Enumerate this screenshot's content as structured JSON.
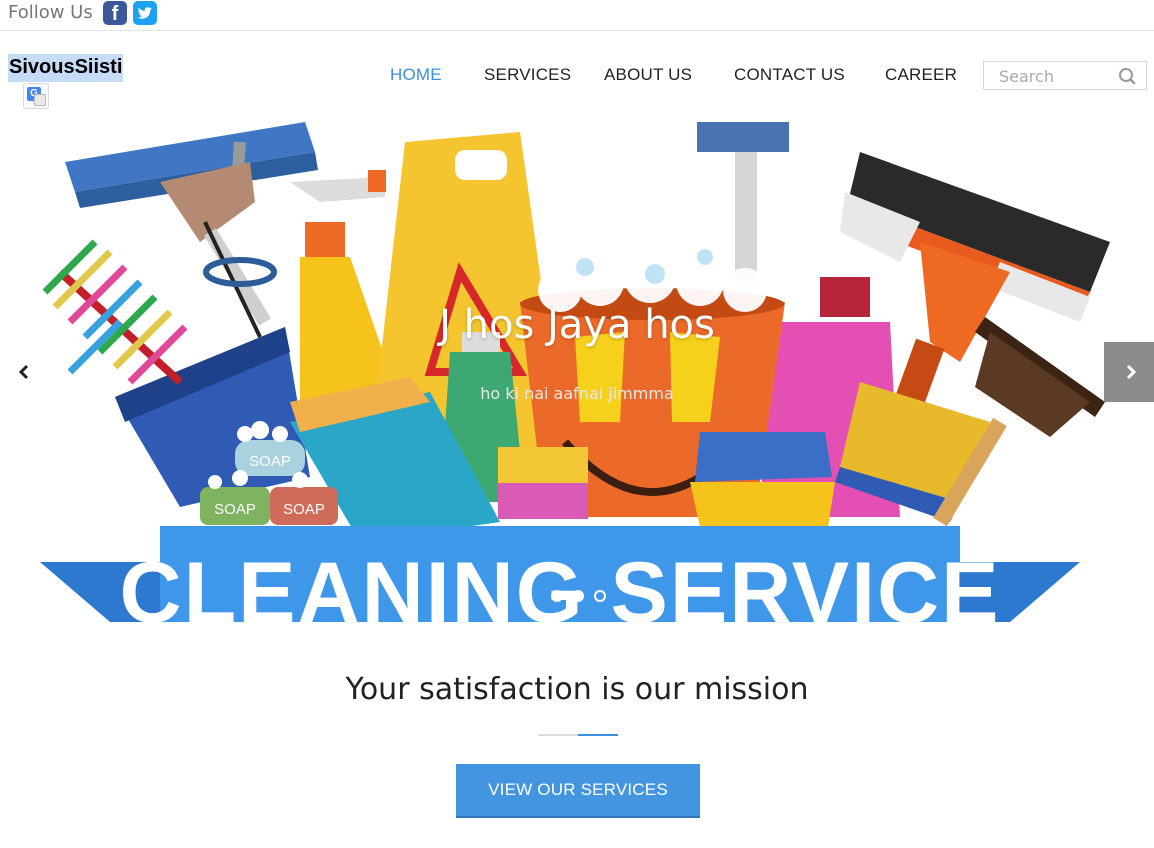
{
  "topbar": {
    "follow_label": "Follow Us",
    "facebook_glyph": "f"
  },
  "header": {
    "brand": "SivousSiisti",
    "translate_glyph": "G"
  },
  "nav": {
    "items": [
      {
        "label": "HOME",
        "active": true
      },
      {
        "label": "SERVICES",
        "active": false
      },
      {
        "label": "ABOUT US",
        "active": false
      },
      {
        "label": "CONTACT US",
        "active": false
      },
      {
        "label": "CAREER",
        "active": false
      }
    ]
  },
  "search": {
    "placeholder": "Search",
    "icon": "magnifier-icon"
  },
  "hero": {
    "title": "J hos Jaya hos",
    "subtitle": "ho ki nai aafnai jimmma",
    "banner_text": "CLEANING SERVICE",
    "soap_label": "SOAP",
    "active_slide": 1,
    "slide_count": 3,
    "prev_icon": "chevron-left-icon",
    "next_icon": "chevron-right-icon"
  },
  "mission": {
    "heading": "Your satisfaction is our mission"
  },
  "cta": {
    "label": "VIEW OUR SERVICES"
  },
  "colors": {
    "accent": "#3d8fd9",
    "button": "#4495e0",
    "banner": "#3f97ea"
  }
}
